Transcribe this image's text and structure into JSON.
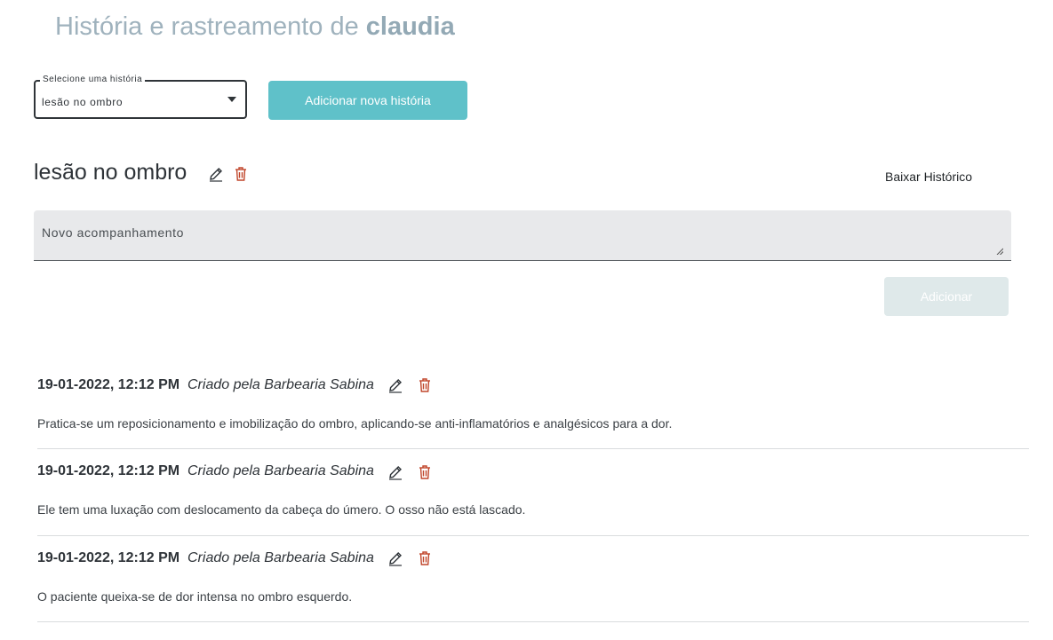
{
  "header": {
    "title_prefix": "História e rastreamento de",
    "patient_name": "claudia"
  },
  "history_select": {
    "label": "Selecione uma história",
    "selected": "lesão no ombro"
  },
  "add_history_button": "Adicionar nova história",
  "current_history": {
    "title": "lesão no ombro",
    "download_label": "Baixar Histórico"
  },
  "followup": {
    "placeholder": "Novo acompanhamento",
    "submit_label": "Adicionar"
  },
  "entries": [
    {
      "date": "19-01-2022, 12:12 PM",
      "author": "Criado pela Barbearia Sabina",
      "text": "Pratica-se um reposicionamento e imobilização do ombro, aplicando-se anti-inflamatórios e analgésicos para a dor."
    },
    {
      "date": "19-01-2022, 12:12 PM",
      "author": "Criado pela Barbearia Sabina",
      "text": "Ele tem uma luxação com deslocamento da cabeça do úmero. O osso não está lascado."
    },
    {
      "date": "19-01-2022, 12:12 PM",
      "author": "Criado pela Barbearia Sabina",
      "text": "O paciente queixa-se de dor intensa no ombro esquerdo."
    }
  ],
  "colors": {
    "accent": "#5fc1c9",
    "delete_icon": "#c0452a",
    "title_muted": "#9fb2bd"
  }
}
